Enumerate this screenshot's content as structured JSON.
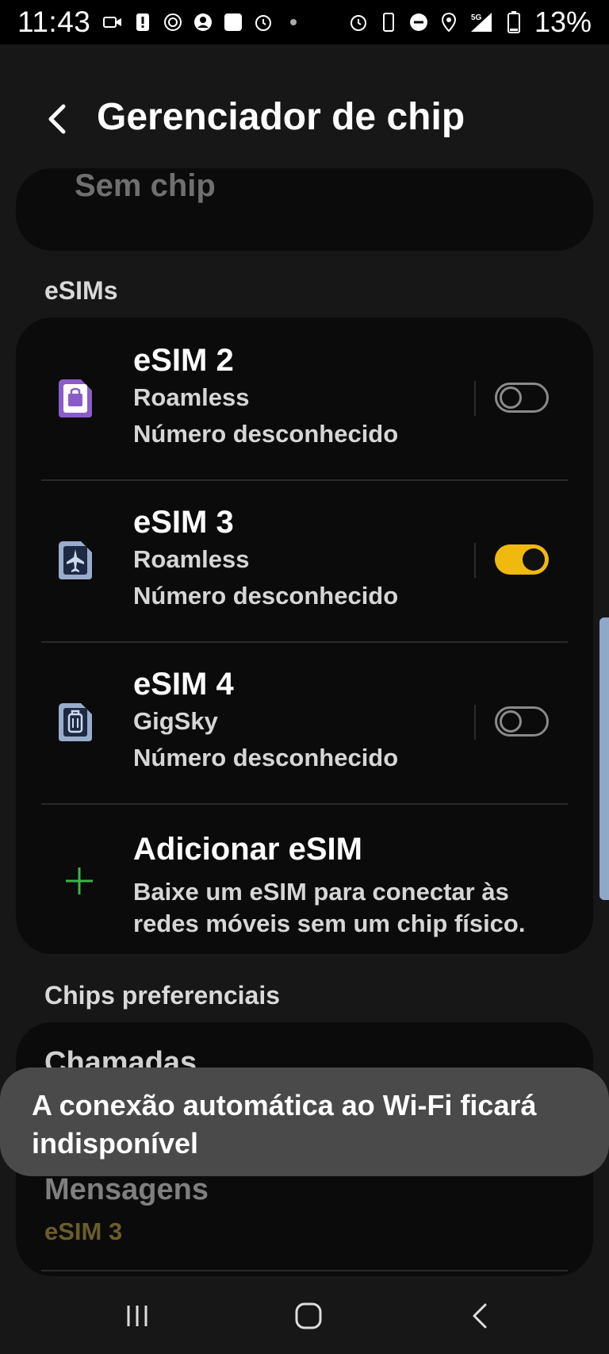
{
  "status_bar": {
    "time": "11:43",
    "battery": "13%",
    "network": "5G",
    "icons_left": [
      "video-icon",
      "alert-icon",
      "sync-icon",
      "account-icon",
      "square-icon",
      "alarm-icon",
      "dot-icon"
    ],
    "icons_right": [
      "alarm-icon",
      "phone-icon",
      "dnd-icon",
      "location-icon",
      "signal-icon",
      "battery-icon"
    ]
  },
  "header": {
    "title": "Gerenciador de chip",
    "back_icon": "back-arrow-icon"
  },
  "no_sim": {
    "label": "Sem chip"
  },
  "esims_section": {
    "label": "eSIMs",
    "items": [
      {
        "name": "eSIM 2",
        "carrier": "Roamless",
        "number": "Número desconhecido",
        "enabled": false,
        "icon": "bag-icon",
        "icon_color": "#8b5cc7"
      },
      {
        "name": "eSIM 3",
        "carrier": "Roamless",
        "number": "Número desconhecido",
        "enabled": true,
        "icon": "airplane-icon",
        "icon_color": "#9aaccc"
      },
      {
        "name": "eSIM 4",
        "carrier": "GigSky",
        "number": "Número desconhecido",
        "enabled": false,
        "icon": "suitcase-icon",
        "icon_color": "#9aaccc"
      }
    ],
    "add": {
      "title": "Adicionar eSIM",
      "description": "Baixe um eSIM para conectar às redes móveis sem um chip físico.",
      "icon": "plus-icon"
    }
  },
  "preferred_section": {
    "label": "Chips preferenciais",
    "calls_label": "Chamadas",
    "messages_label": "Mensagens",
    "messages_value": "eSIM 3"
  },
  "toast": {
    "text": "A conexão automática ao Wi‑Fi ficará indisponível"
  },
  "colors": {
    "accent": "#f0b90f",
    "background": "#171717",
    "card": "#0b0b0b",
    "toast": "#4a4a4a"
  },
  "nav": {
    "recent_icon": "recents-icon",
    "home_icon": "home-icon",
    "back_icon": "back-icon"
  }
}
